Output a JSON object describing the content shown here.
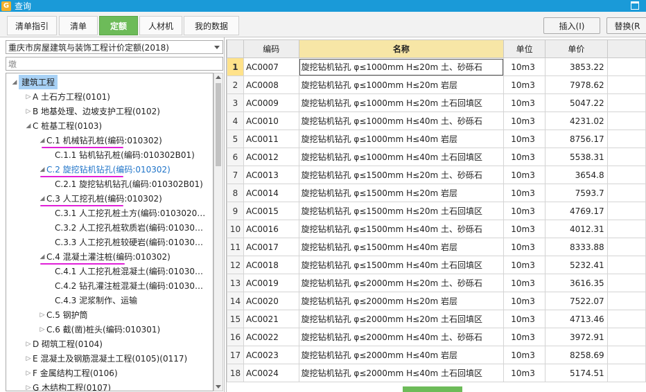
{
  "window": {
    "title": "查询"
  },
  "tabs": [
    {
      "label": "清单指引"
    },
    {
      "label": "清单"
    },
    {
      "label": "定额"
    },
    {
      "label": "人材机"
    },
    {
      "label": "我的数据"
    }
  ],
  "toolbar": {
    "insert_label": "插入(I)",
    "replace_label": "替换(R"
  },
  "library": {
    "selected": "重庆市房屋建筑与装饰工程计价定额(2018)"
  },
  "search": {
    "value": "墩"
  },
  "tree": [
    {
      "label": "建筑工程"
    },
    {
      "label": "A 土石方工程(0101)"
    },
    {
      "label": "B 地基处理、边坡支护工程(0102)"
    },
    {
      "label": "C 桩基工程(0103)"
    },
    {
      "label": "C.1 机械钻孔桩(编码:010302)"
    },
    {
      "label": "C.1.1 钻机钻孔桩(编码:010302B01)"
    },
    {
      "label": "C.2 旋挖钻机钻孔(编码:010302)"
    },
    {
      "label": "C.2.1 旋挖钻机钻孔(编码:010302B01)"
    },
    {
      "label": "C.3 人工挖孔桩(编码:010302)"
    },
    {
      "label": "C.3.1 人工挖孔桩土方(编码:0103020…"
    },
    {
      "label": "C.3.2 人工挖孔桩软质岩(编码:01030…"
    },
    {
      "label": "C.3.3 人工挖孔桩较硬岩(编码:01030…"
    },
    {
      "label": "C.4 混凝土灌注桩(编码:010302)"
    },
    {
      "label": "C.4.1 人工挖孔桩混凝土(编码:01030…"
    },
    {
      "label": "C.4.2 钻孔灌注桩混凝土(编码:01030…"
    },
    {
      "label": "C.4.3 泥浆制作、运输"
    },
    {
      "label": "C.5 钢护筒"
    },
    {
      "label": "C.6 截(凿)桩头(编码:010301)"
    },
    {
      "label": "D 砌筑工程(0104)"
    },
    {
      "label": "E 混凝土及钢筋混凝土工程(0105)(0117)"
    },
    {
      "label": "F 金属结构工程(0106)"
    },
    {
      "label": "G 木结构工程(0107)"
    }
  ],
  "table": {
    "headers": {
      "code": "编码",
      "name": "名称",
      "unit": "单位",
      "price": "单价"
    },
    "rows": [
      {
        "no": "1",
        "code": "AC0007",
        "name": "旋挖钻机钻孔 φ≤1000mm H≤20m 土、砂砾石",
        "unit": "10m3",
        "price": "3853.22"
      },
      {
        "no": "2",
        "code": "AC0008",
        "name": "旋挖钻机钻孔 φ≤1000mm H≤20m 岩层",
        "unit": "10m3",
        "price": "7978.62"
      },
      {
        "no": "3",
        "code": "AC0009",
        "name": "旋挖钻机钻孔 φ≤1000mm H≤20m 土石回填区",
        "unit": "10m3",
        "price": "5047.22"
      },
      {
        "no": "4",
        "code": "AC0010",
        "name": "旋挖钻机钻孔 φ≤1000mm H≤40m 土、砂砾石",
        "unit": "10m3",
        "price": "4231.02"
      },
      {
        "no": "5",
        "code": "AC0011",
        "name": "旋挖钻机钻孔 φ≤1000mm H≤40m 岩层",
        "unit": "10m3",
        "price": "8756.17"
      },
      {
        "no": "6",
        "code": "AC0012",
        "name": "旋挖钻机钻孔 φ≤1000mm H≤40m 土石回填区",
        "unit": "10m3",
        "price": "5538.31"
      },
      {
        "no": "7",
        "code": "AC0013",
        "name": "旋挖钻机钻孔 φ≤1500mm H≤20m 土、砂砾石",
        "unit": "10m3",
        "price": "3654.8"
      },
      {
        "no": "8",
        "code": "AC0014",
        "name": "旋挖钻机钻孔 φ≤1500mm H≤20m 岩层",
        "unit": "10m3",
        "price": "7593.7"
      },
      {
        "no": "9",
        "code": "AC0015",
        "name": "旋挖钻机钻孔 φ≤1500mm H≤20m 土石回填区",
        "unit": "10m3",
        "price": "4769.17"
      },
      {
        "no": "10",
        "code": "AC0016",
        "name": "旋挖钻机钻孔 φ≤1500mm H≤40m 土、砂砾石",
        "unit": "10m3",
        "price": "4012.31"
      },
      {
        "no": "11",
        "code": "AC0017",
        "name": "旋挖钻机钻孔 φ≤1500mm H≤40m 岩层",
        "unit": "10m3",
        "price": "8333.88"
      },
      {
        "no": "12",
        "code": "AC0018",
        "name": "旋挖钻机钻孔 φ≤1500mm H≤40m 土石回填区",
        "unit": "10m3",
        "price": "5232.41"
      },
      {
        "no": "13",
        "code": "AC0019",
        "name": "旋挖钻机钻孔 φ≤2000mm H≤20m 土、砂砾石",
        "unit": "10m3",
        "price": "3616.35"
      },
      {
        "no": "14",
        "code": "AC0020",
        "name": "旋挖钻机钻孔 φ≤2000mm H≤20m 岩层",
        "unit": "10m3",
        "price": "7522.07"
      },
      {
        "no": "15",
        "code": "AC0021",
        "name": "旋挖钻机钻孔 φ≤2000mm H≤20m 土石回填区",
        "unit": "10m3",
        "price": "4713.46"
      },
      {
        "no": "16",
        "code": "AC0022",
        "name": "旋挖钻机钻孔 φ≤2000mm H≤40m 土、砂砾石",
        "unit": "10m3",
        "price": "3972.91"
      },
      {
        "no": "17",
        "code": "AC0023",
        "name": "旋挖钻机钻孔 φ≤2000mm H≤40m 岩层",
        "unit": "10m3",
        "price": "8258.69"
      },
      {
        "no": "18",
        "code": "AC0024",
        "name": "旋挖钻机钻孔 φ≤2000mm H≤40m 土石回填区",
        "unit": "10m3",
        "price": "5174.51"
      }
    ]
  },
  "colors": {
    "titlebar": "#1a9ad8",
    "active_tab": "#6dbb59",
    "annotation": "#e020d8",
    "selected_tree": "#a8d1f5",
    "name_header": "#f7e6a6"
  },
  "icons": {
    "app": "app-logo-icon",
    "maximize": "maximize-icon",
    "dropdown": "chevron-down-icon",
    "expand": "triangle-expand-icon"
  }
}
